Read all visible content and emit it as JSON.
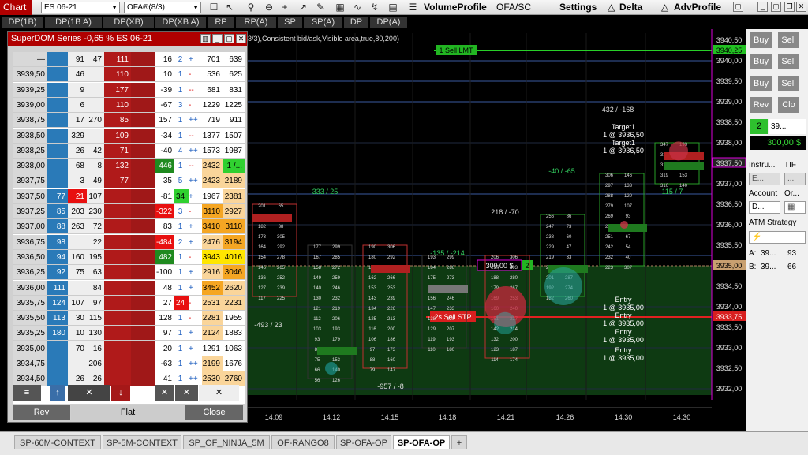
{
  "toolbar": {
    "chart_tab": "Chart",
    "instrument": "ES 06-21",
    "template": "OFA®(8/3)",
    "volume_profile": "VolumeProfile",
    "ofa_sc": "OFA/SC",
    "settings": "Settings",
    "delta": "Delta",
    "adv_profile": "AdvProfile"
  },
  "indicators": [
    "DP(1B)",
    "DP(1B A)",
    "DP(XB)",
    "DP(XB A)",
    "RP",
    "RP(A)",
    "SP",
    "SP(A)",
    "DP",
    "DP(A)"
  ],
  "chart": {
    "legend_text": "3/3),Consistent bid/ask,Visible area,true,80,200)",
    "price_labels": [
      "3940,50",
      "3940,25",
      "3940,00",
      "3939,50",
      "3939,00",
      "3938,50",
      "3938,00",
      "3937,50",
      "3937,00",
      "3936,50",
      "3936,00",
      "3935,50",
      "3935,00",
      "3934,50",
      "3934,00",
      "3933,75",
      "3933,50",
      "3933,00",
      "3932,50",
      "3932,00"
    ],
    "time_labels": [
      "14:09",
      "14:12",
      "14:15",
      "14:18",
      "14:21",
      "14:26",
      "14:30",
      "14:30"
    ],
    "sell_lmt_label": "1  Sell LMT",
    "sell_stp_label": "2s  Sell STP",
    "position_label": "300,00 $",
    "position_qty": "2",
    "target1_a": "Target1",
    "target1_b": "1 @ 3936,50",
    "target1_c": "Target1",
    "target1_d": "1 @ 3936,50",
    "entry_a": "Entry",
    "entry_b": "1 @ 3935,00",
    "entry_c": "Entry",
    "entry_d": "1 @ 3935,00",
    "entry_e": "Entry",
    "entry_f": "1 @ 3935,00",
    "entry_g": "Entry",
    "entry_h": "1 @ 3935,00",
    "delta_labels": [
      "333 / 25",
      "218 / -70",
      "-40 / -65",
      "432 / -168",
      "-135 / -214",
      "-493 / 23",
      "115 / 7",
      "-957 / -8"
    ]
  },
  "right_panel": {
    "buy_labels": [
      "Buy",
      "Buy",
      "Buy"
    ],
    "sell_labels": [
      "Sell",
      "Sell",
      "Sell"
    ],
    "rev": "Rev",
    "close": "Clo",
    "position_qty": "2",
    "position_price": "39...",
    "pnl": "300,00 $",
    "instrument_label": "Instru...",
    "tif_label": "TIF",
    "account_label": "Account",
    "order_label": "Or...",
    "account_value": "D...",
    "atm_label": "ATM Strategy",
    "a_label": "A:",
    "a_price": "39...",
    "a_size": "93",
    "b_label": "B:",
    "b_price": "39...",
    "b_size": "66"
  },
  "dom": {
    "title": "SuperDOM Series -0,65 % ES 06-21",
    "rev": "Rev",
    "flat": "Flat",
    "close": "Close",
    "rows": [
      {
        "price": "—",
        "bid": "",
        "c2": "91",
        "c3": "47",
        "ask": "111",
        "d": "16",
        "x": "2",
        "xs": "+",
        "v1": "701",
        "v2": "639"
      },
      {
        "price": "3939,50",
        "bid": "",
        "c2": "46",
        "c3": "",
        "ask": "110",
        "d": "10",
        "x": "1",
        "xs": "-",
        "v1": "536",
        "v2": "625"
      },
      {
        "price": "3939,25",
        "bid": "",
        "c2": "9",
        "c3": "",
        "ask": "177",
        "d": "-39",
        "x": "1",
        "xs": "--",
        "v1": "681",
        "v2": "831"
      },
      {
        "price": "3939,00",
        "bid": "",
        "c2": "6",
        "c3": "",
        "ask": "110",
        "d": "-67",
        "x": "3",
        "xs": "-",
        "v1": "1229",
        "v2": "1225"
      },
      {
        "price": "3938,75",
        "bid": "",
        "c2": "17",
        "c3": "270",
        "ask": "85",
        "d": "157",
        "x": "1",
        "xs": "++",
        "v1": "719",
        "v2": "911"
      },
      {
        "price": "3938,50",
        "bid": "",
        "c2": "329",
        "c3": "",
        "ask": "109",
        "d": "-34",
        "x": "1",
        "xs": "--",
        "v1": "1377",
        "v2": "1507"
      },
      {
        "price": "3938,25",
        "bid": "",
        "c2": "26",
        "c3": "42",
        "ask": "71",
        "d": "-40",
        "x": "4",
        "xs": "++",
        "v1": "1573",
        "v2": "1987"
      },
      {
        "price": "3938,00",
        "bid": "",
        "c2": "68",
        "c3": "8",
        "ask": "132",
        "d": "446",
        "x": "1",
        "xs": "--",
        "v1": "2432",
        "v2": "1 /..."
      },
      {
        "price": "3937,75",
        "bid": "",
        "c2": "3",
        "c3": "49",
        "ask": "77",
        "d": "35",
        "x": "5",
        "xs": "++",
        "v1": "2423",
        "v2": "2189"
      },
      {
        "price": "3937,50",
        "bid": "77",
        "c2": "21",
        "c3": "107",
        "ask": "",
        "d": "-81",
        "x": "34",
        "xs": "+",
        "v1": "1967",
        "v2": "2381"
      },
      {
        "price": "3937,25",
        "bid": "85",
        "c2": "203",
        "c3": "230",
        "ask": "",
        "d": "-322",
        "x": "3",
        "xs": "-",
        "v1": "3110",
        "v2": "2927"
      },
      {
        "price": "3937,00",
        "bid": "88",
        "c2": "263",
        "c3": "72",
        "ask": "",
        "d": "83",
        "x": "1",
        "xs": "+",
        "v1": "3410",
        "v2": "3110"
      },
      {
        "price": "3936,75",
        "bid": "98",
        "c2": "",
        "c3": "22",
        "ask": "",
        "d": "-484",
        "x": "2",
        "xs": "+",
        "v1": "2476",
        "v2": "3194"
      },
      {
        "price": "3936,50",
        "bid": "94",
        "c2": "160",
        "c3": "195",
        "ask": "",
        "d": "482",
        "x": "1",
        "xs": "-",
        "v1": "3943",
        "v2": "4016"
      },
      {
        "price": "3936,25",
        "bid": "92",
        "c2": "75",
        "c3": "63",
        "ask": "",
        "d": "-100",
        "x": "1",
        "xs": "+",
        "v1": "2916",
        "v2": "3046"
      },
      {
        "price": "3936,00",
        "bid": "111",
        "c2": "",
        "c3": "84",
        "ask": "",
        "d": "48",
        "x": "1",
        "xs": "+",
        "v1": "3452",
        "v2": "2620"
      },
      {
        "price": "3935,75",
        "bid": "124",
        "c2": "107",
        "c3": "97",
        "ask": "",
        "d": "27",
        "x": "24",
        "xs": "-",
        "v1": "2531",
        "v2": "2231"
      },
      {
        "price": "3935,50",
        "bid": "113",
        "c2": "30",
        "c3": "115",
        "ask": "",
        "d": "128",
        "x": "1",
        "xs": "-",
        "v1": "2281",
        "v2": "1955"
      },
      {
        "price": "3935,25",
        "bid": "180",
        "c2": "10",
        "c3": "130",
        "ask": "",
        "d": "97",
        "x": "1",
        "xs": "+",
        "v1": "2124",
        "v2": "1883"
      },
      {
        "price": "3935,00",
        "bid": "",
        "c2": "70",
        "c3": "16",
        "ask": "",
        "d": "20",
        "x": "1",
        "xs": "+",
        "v1": "1291",
        "v2": "1063"
      },
      {
        "price": "3934,75",
        "bid": "",
        "c2": "",
        "c3": "206",
        "ask": "",
        "d": "-63",
        "x": "1",
        "xs": "++",
        "v1": "2199",
        "v2": "1676"
      },
      {
        "price": "3934,50",
        "bid": "",
        "c2": "26",
        "c3": "26",
        "ask": "",
        "d": "41",
        "x": "1",
        "xs": "++",
        "v1": "2530",
        "v2": "2760"
      }
    ]
  },
  "tabs": [
    "SP-60M-CONTEXT",
    "SP-5M-CONTEXT",
    "SP_OF_NINJA_5M",
    "OF-RANGO8",
    "SP-OFA-OP",
    "SP-OFA-OP",
    "+"
  ],
  "active_tab_index": 5
}
